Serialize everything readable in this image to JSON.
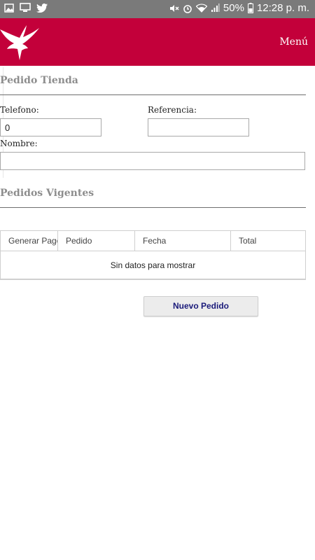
{
  "status_bar": {
    "battery": "50%",
    "time": "12:28 p. m.",
    "icons_left": [
      "image-icon",
      "monitor-icon",
      "twitter-icon"
    ],
    "icons_right": [
      "mute-icon",
      "alarm-icon",
      "wifi-icon",
      "signal-icon",
      "battery-icon"
    ]
  },
  "header": {
    "menu_label": "Menú",
    "logo": "bird-logo",
    "color": "#c3003a"
  },
  "form": {
    "title": "Pedido Tienda",
    "telefono_label": "Telefono:",
    "telefono_value": "0",
    "referencia_label": "Referencia:",
    "referencia_value": "",
    "nombre_label": "Nombre:",
    "nombre_value": ""
  },
  "orders": {
    "title": "Pedidos Vigentes",
    "columns": [
      "Generar Pago",
      "Pedido",
      "Fecha",
      "Total"
    ],
    "empty_text": "Sin datos para mostrar"
  },
  "actions": {
    "new_order_label": "Nuevo Pedido"
  }
}
